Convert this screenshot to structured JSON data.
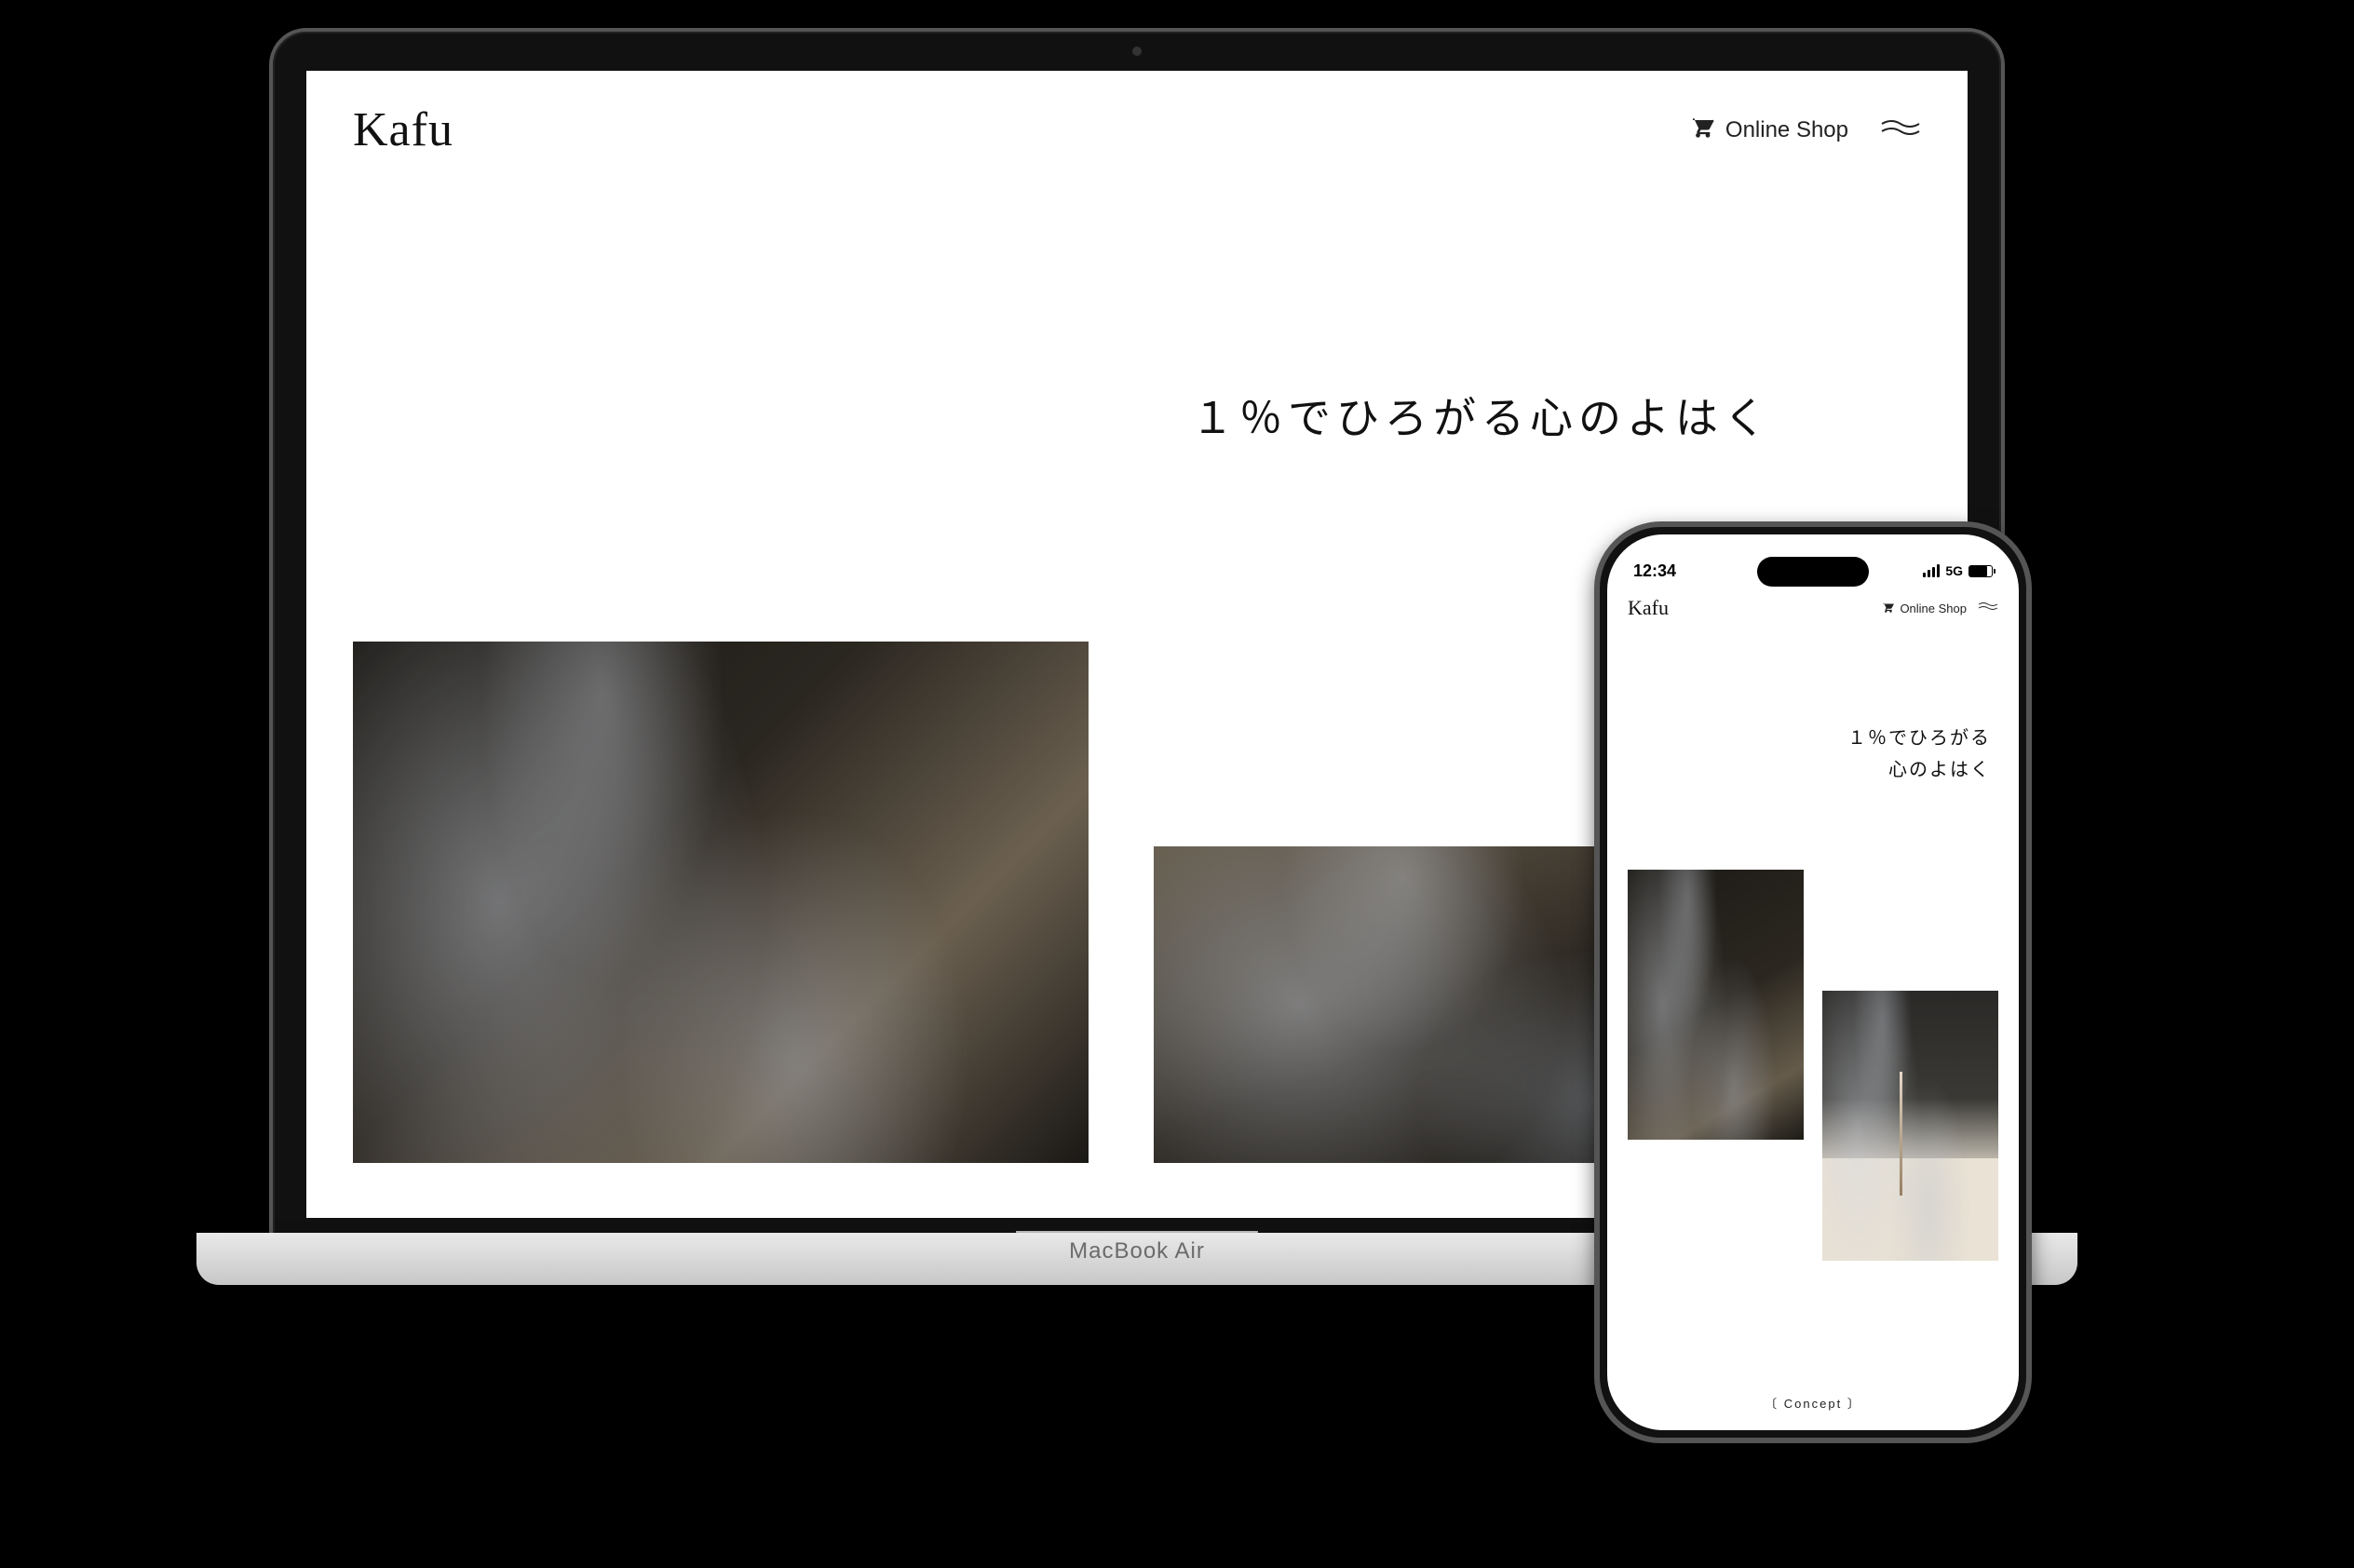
{
  "devices": {
    "macbook_label": "MacBook Air"
  },
  "desktop": {
    "logo": "Kafu",
    "nav": {
      "shop_label": "Online Shop"
    },
    "tagline": "１％でひろがる心のよはく"
  },
  "mobile": {
    "statusbar": {
      "time": "12:34",
      "network": "5G"
    },
    "logo": "Kafu",
    "nav": {
      "shop_label": "Online Shop"
    },
    "tagline_line1": "１％でひろがる",
    "tagline_line2": "心のよはく",
    "footer": {
      "left_paren": "〔",
      "label": "Concept",
      "right_paren": "〕"
    }
  }
}
